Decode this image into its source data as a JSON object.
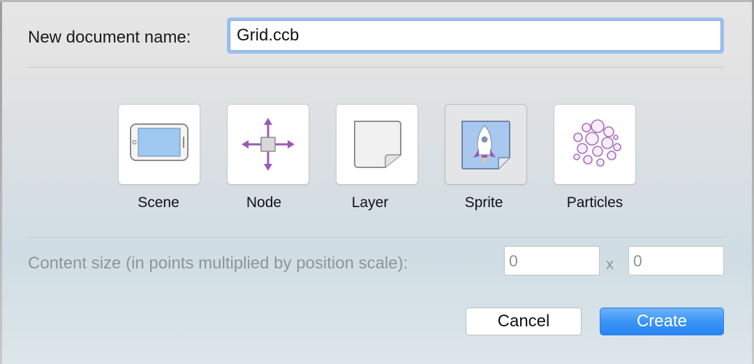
{
  "dialog": {
    "name_label": "New document name:",
    "name_value": "Grid.ccb"
  },
  "templates": [
    {
      "label": "Scene",
      "icon": "phone-scene-icon",
      "selected": false
    },
    {
      "label": "Node",
      "icon": "move-arrows-icon",
      "selected": false
    },
    {
      "label": "Layer",
      "icon": "page-layer-icon",
      "selected": false
    },
    {
      "label": "Sprite",
      "icon": "rocket-sprite-icon",
      "selected": true
    },
    {
      "label": "Particles",
      "icon": "bubbles-particles-icon",
      "selected": false
    }
  ],
  "content_size": {
    "label": "Content size (in points multiplied by position scale):",
    "width_value": "0",
    "separator": "x",
    "height_value": "0"
  },
  "buttons": {
    "cancel_label": "Cancel",
    "create_label": "Create"
  },
  "colors": {
    "accent": "#2683f2",
    "focus_ring": "#9cc0ec",
    "icon_purple": "#9b59b6"
  }
}
